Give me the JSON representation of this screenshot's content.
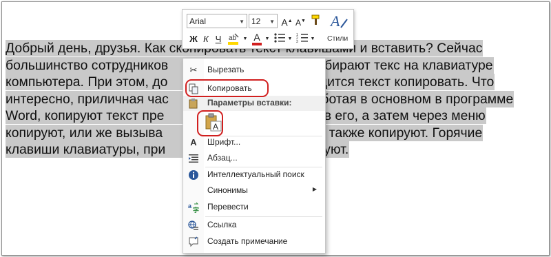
{
  "document": {
    "lines": [
      {
        "a": "Добрый день, друзья. Как ",
        "b": "скопировать текст клавишами и вставить? Сейчас"
      },
      {
        "a": "большинство сотрудников ",
        "b": "набирают текс на клавиатуре"
      },
      {
        "a": "компьютера. При этом, до",
        "b": "водится текст копировать. Что"
      },
      {
        "a": "интересно, приличная час",
        "b": "работая в основном в программе"
      },
      {
        "a": "Word, копируют текст пре",
        "b": "елив его, а затем через меню"
      },
      {
        "a": "копируют, или же вызыва",
        "b": "ю, и также копируют. Горячие"
      },
      {
        "a": "клавиши клавиатуры, при",
        "b": "льзуют."
      }
    ]
  },
  "mini_toolbar": {
    "font_name": "Arial",
    "font_size": "12",
    "grow_font": "A",
    "shrink_font": "A",
    "bold": "Ж",
    "italic": "К",
    "underline": "Ч",
    "font_color": "A",
    "styles_label": "Стили",
    "accent_color": "#2b579a",
    "highlight_color": "#ffd800",
    "font_color_value": "#d11f1f"
  },
  "context_menu": {
    "cut": "Вырезать",
    "copy": "Копировать",
    "paste_options": "Параметры вставки:",
    "font": "Шрифт...",
    "paragraph": "Абзац...",
    "smart_lookup": "Интеллектуальный поиск",
    "synonyms": "Синонимы",
    "translate": "Перевести",
    "link": "Ссылка",
    "new_comment": "Создать примечание"
  },
  "highlight_color": "#d11f1f"
}
